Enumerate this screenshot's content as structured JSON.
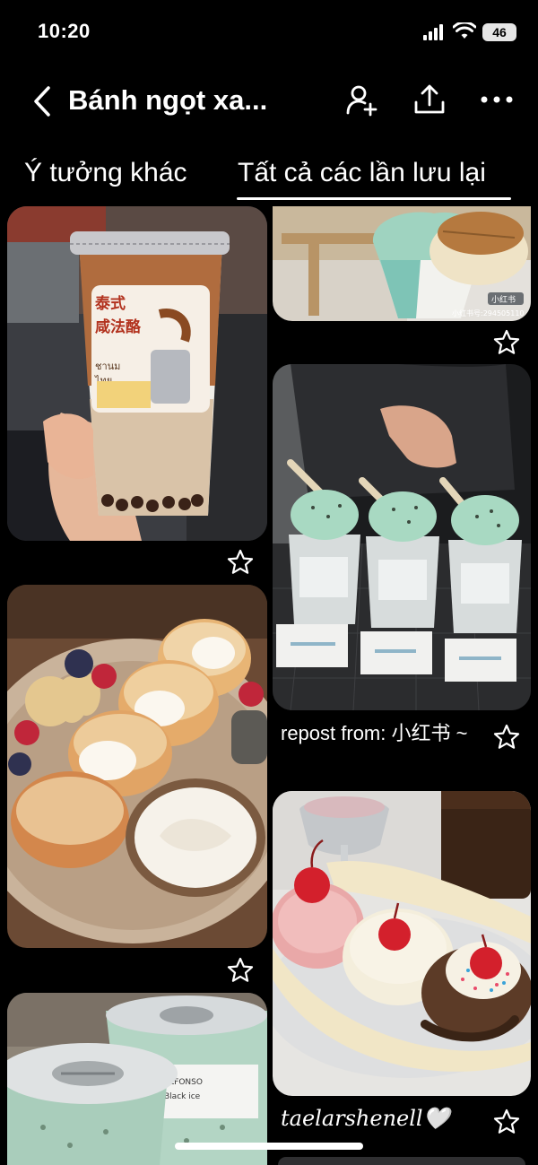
{
  "status_bar": {
    "time": "10:20",
    "battery": "46"
  },
  "header": {
    "title": "Bánh ngọt xa..."
  },
  "tabs": [
    {
      "label": "Ý tưởng khác",
      "selected": false
    },
    {
      "label": "Tất cả các lần lưu lại",
      "selected": true
    }
  ],
  "pins": [
    {
      "name": "thai-cheese-milk-tea",
      "labels": [
        "泰式",
        "咸法酪",
        "ชานม",
        "ไทย"
      ]
    },
    {
      "name": "mint-ice-cream-cone",
      "labels": [
        "小红书",
        "小红书号:294505110"
      ]
    },
    {
      "name": "mint-chip-cups",
      "caption": "repost from: 小红书 ~"
    },
    {
      "name": "souffle-pancakes"
    },
    {
      "name": "banana-split",
      "caption": "taelarshenell🤍"
    },
    {
      "name": "mint-drink-cups",
      "labels": [
        "ALFONSO",
        "Black ice"
      ]
    }
  ],
  "colors": {
    "background": "#000000",
    "text": "#ffffff"
  }
}
